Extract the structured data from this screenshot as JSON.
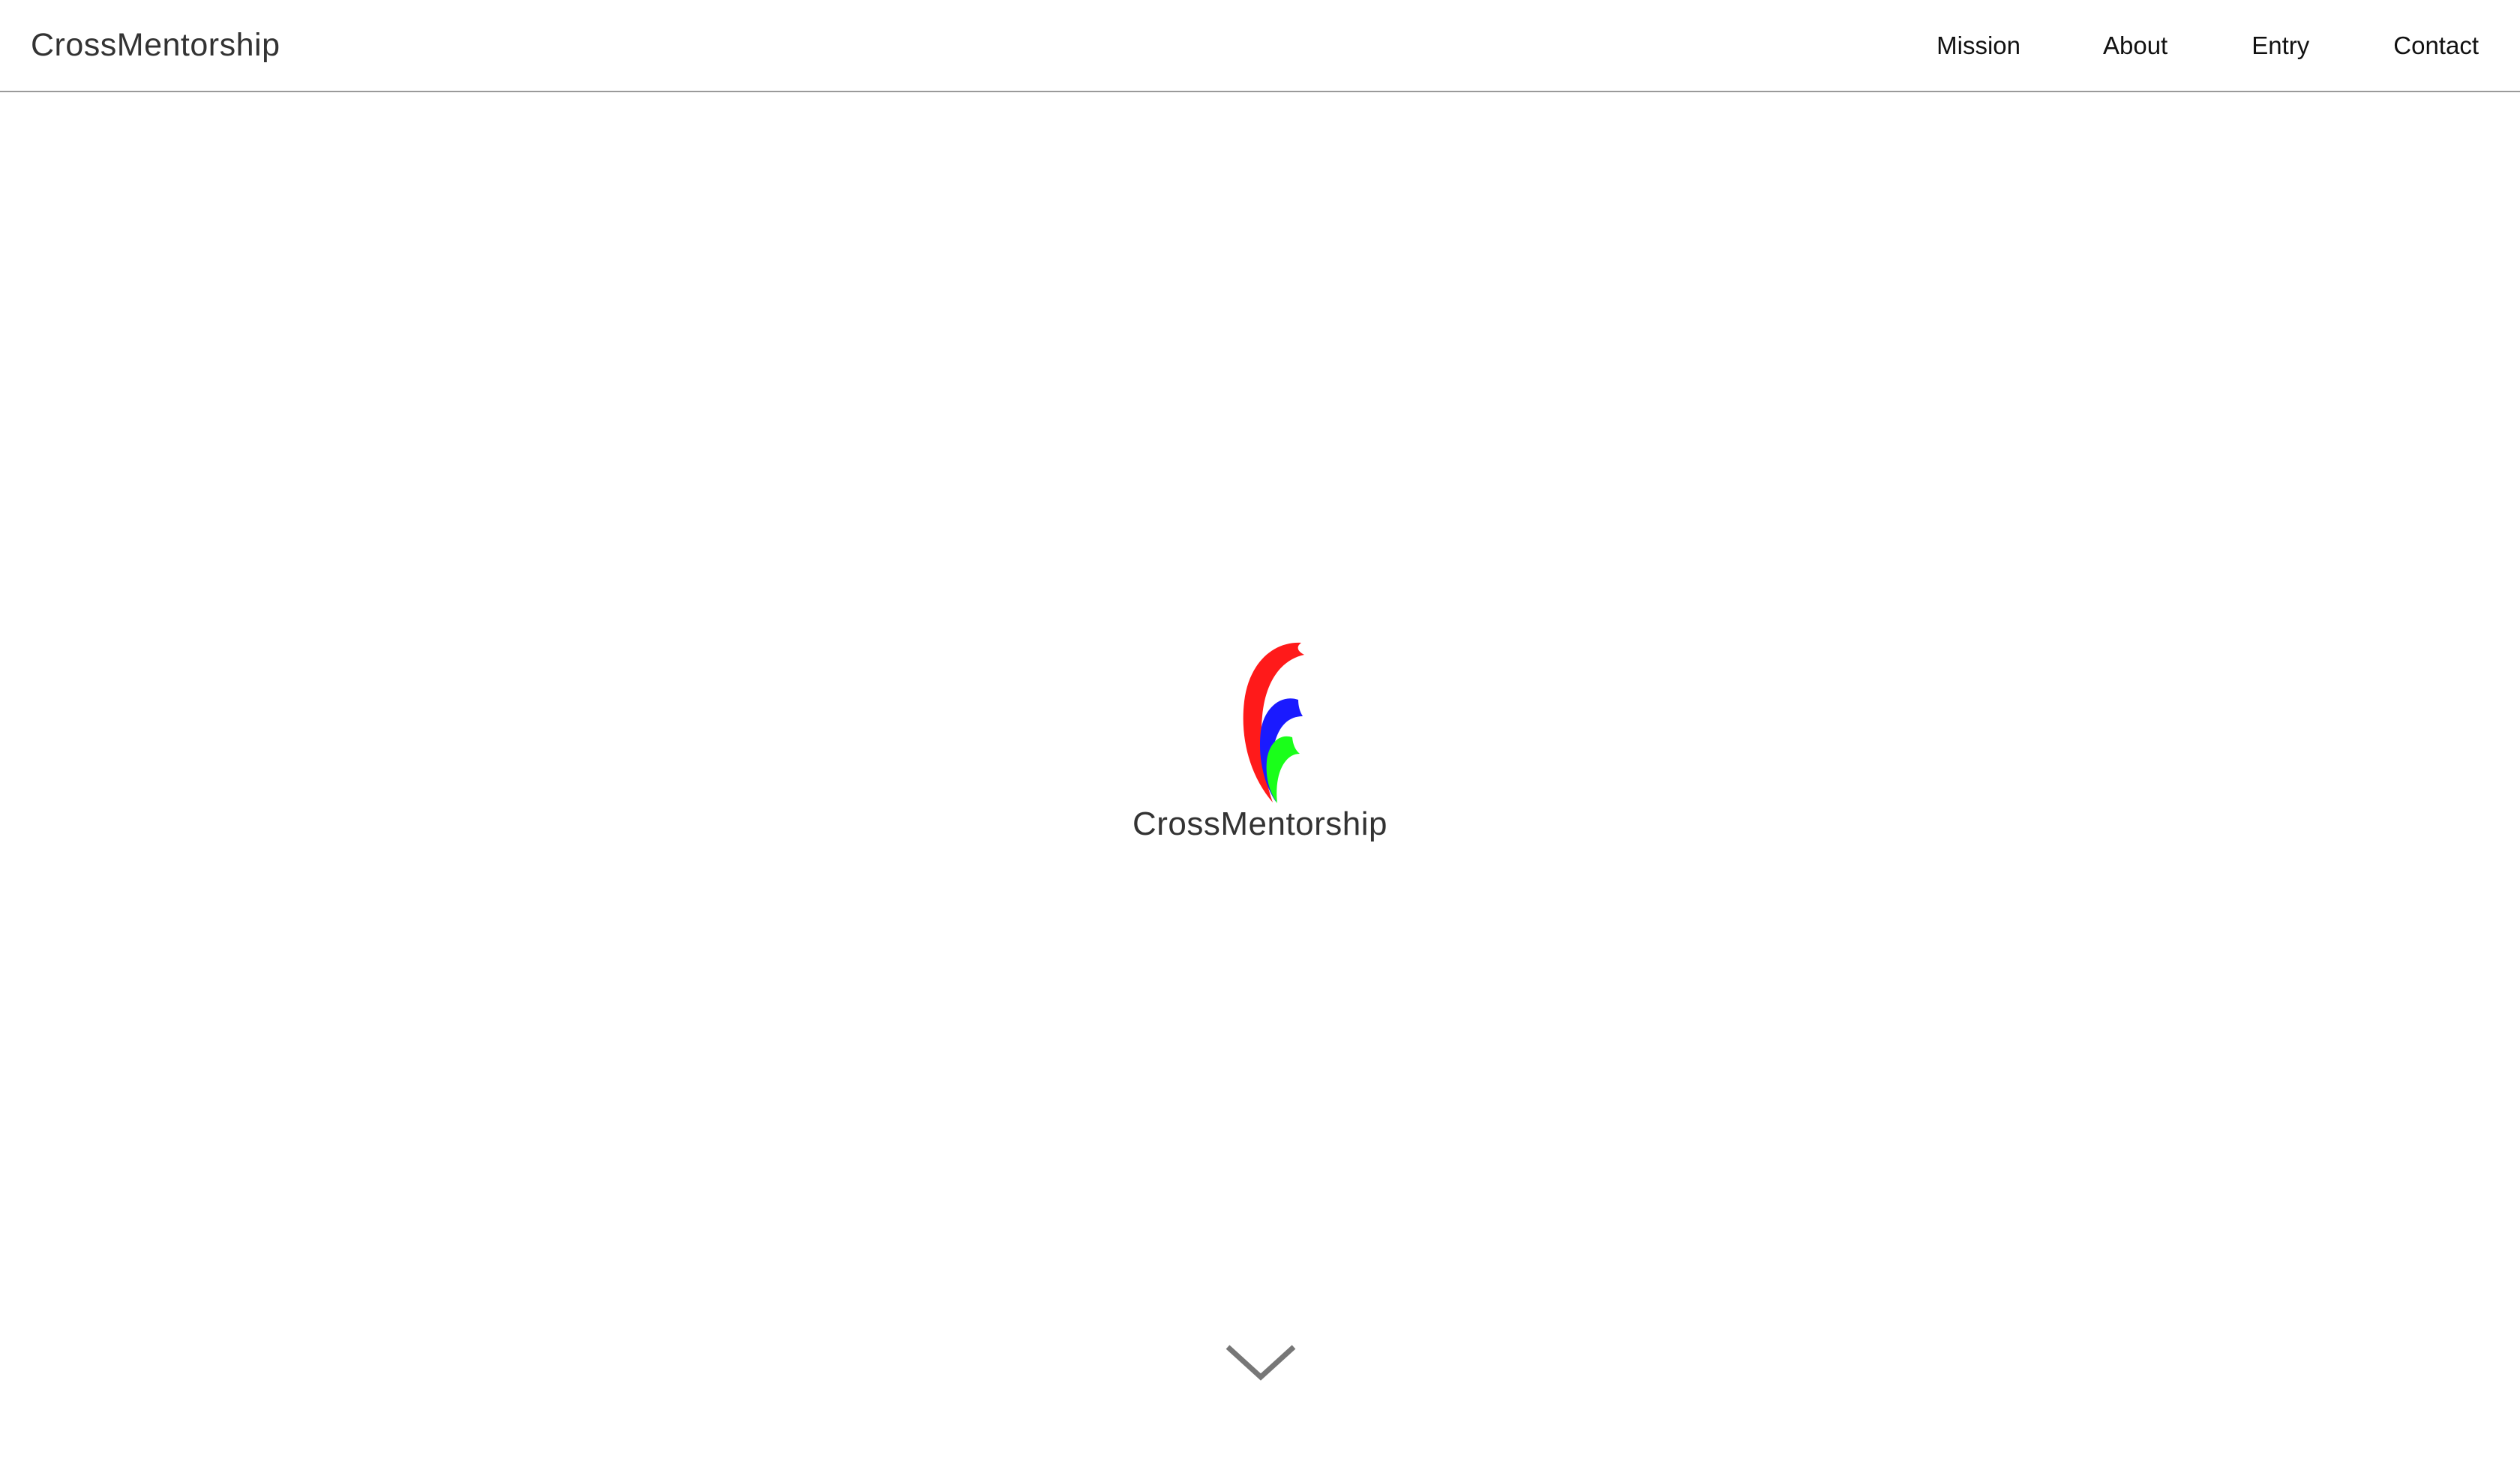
{
  "header": {
    "brand": "CrossMentorship",
    "nav": [
      {
        "label": "Mission"
      },
      {
        "label": "About"
      },
      {
        "label": "Entry"
      },
      {
        "label": "Contact"
      }
    ]
  },
  "hero": {
    "logo_text": "CrossMentorship",
    "logo_icon": "tricolor-flame-logo",
    "scroll_icon": "chevron-down-icon"
  },
  "colors": {
    "logo_red": "#ff1a1a",
    "logo_blue": "#1a1aff",
    "logo_green": "#1aff1a",
    "divider": "#9a9a9a",
    "chevron": "#777777"
  }
}
